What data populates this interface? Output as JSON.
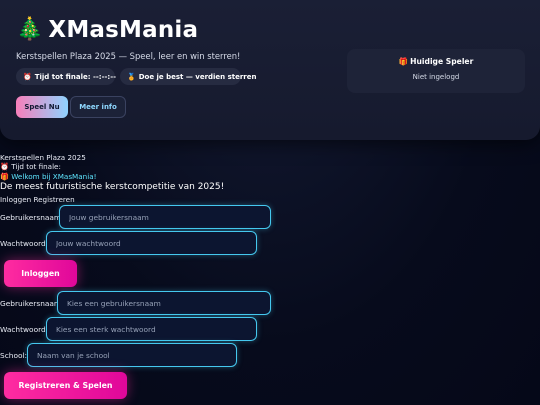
{
  "header": {
    "title": "XMasMania",
    "title_icon": "christmas-tree",
    "subtitle": "Kerstspellen Plaza 2025 — Speel, leer en win sterren!",
    "timer_pill": {
      "icon": "alarm-clock",
      "label": "Tijd tot finale:",
      "value": "--:--:--"
    },
    "best_pill": {
      "icon": "medal",
      "label": "Doe je best — verdien sterren"
    },
    "play_button": "Speel Nu",
    "info_button": "Meer info",
    "player_card": {
      "icon": "gift",
      "title": "Huidige Speler",
      "status": "Niet ingelogd"
    }
  },
  "content": {
    "plaza_title": "Kerstspellen Plaza 2025",
    "timer_text": "Tijd tot finale:",
    "timer_icon": "alarm-clock",
    "welcome_icon": "gift",
    "welcome_text": "Welkom bij XMasMania!",
    "tagline": "De meest futuristische kerstcompetitie van 2025!",
    "auth_tabs": "Inloggen Registreren"
  },
  "login": {
    "username_label": "Gebruikersnaam:",
    "username_placeholder": "Jouw gebruikersnaam",
    "password_label": "Wachtwoord:",
    "password_placeholder": "Jouw wachtwoord",
    "submit_label": "Inloggen"
  },
  "register": {
    "username_label": "Gebruikersnaam:",
    "username_placeholder": "Kies een gebruikersnaam",
    "password_label": "Wachtwoord:",
    "password_placeholder": "Kies een sterk wachtwoord",
    "school_label": "School:",
    "school_placeholder": "Naam van je school",
    "submit_label": "Registreren & Spelen"
  },
  "colors": {
    "background": "#070b1c",
    "header": "#1a1f35",
    "accent_cyan": "#45c8ef",
    "accent_pink": "#ff2ca0",
    "welcome_cyan": "#5ee6ff"
  }
}
